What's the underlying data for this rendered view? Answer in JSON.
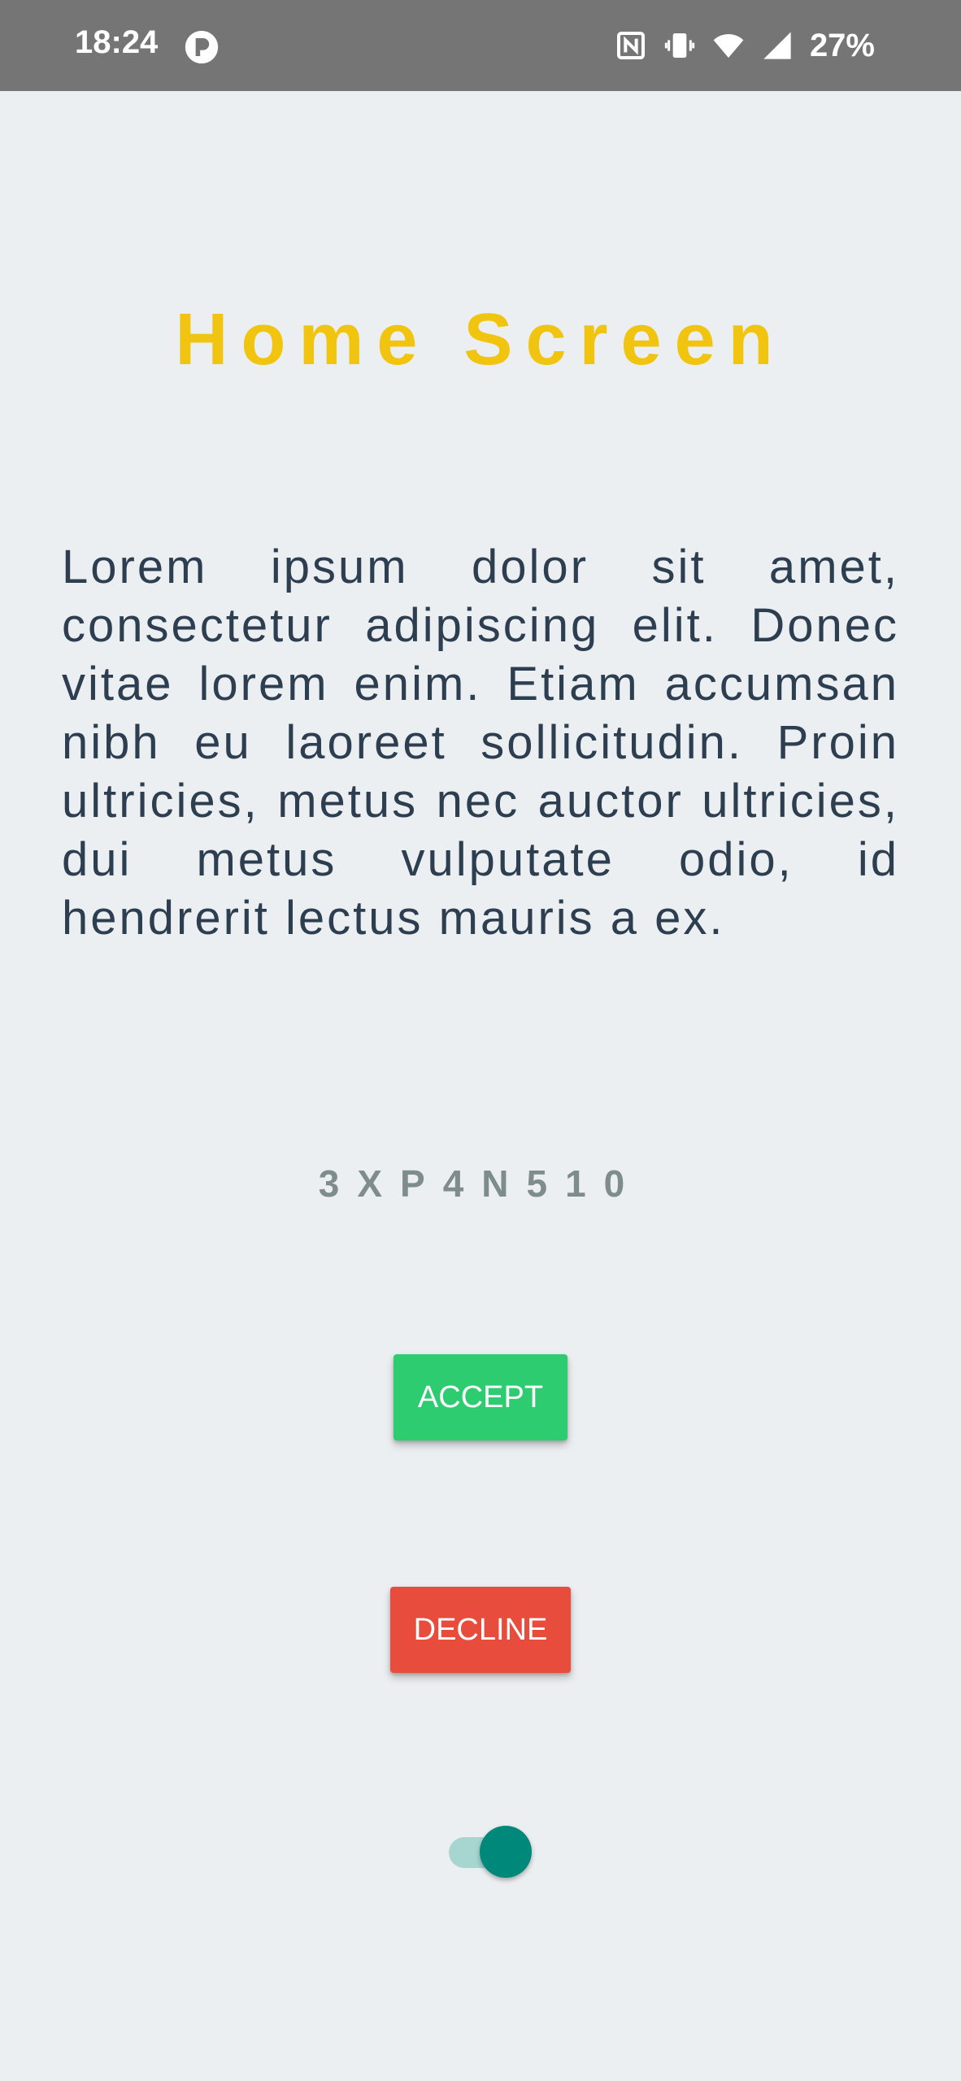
{
  "status_bar": {
    "time": "18:24",
    "battery_percent": "27%",
    "icons": [
      "app-notification-icon",
      "nfc-icon",
      "vibrate-icon",
      "wifi-icon",
      "cellular-signal-icon"
    ]
  },
  "screen": {
    "title": "Home Screen",
    "body": "Lorem ipsum dolor sit amet, consectetur adipiscing elit. Donec vitae lorem enim. Etiam accumsan nibh eu laoreet sollicitudin. Proin ultricies, metus nec auctor ultricies, dui metus vulputate odio, id hendrerit lectus mauris a ex.",
    "code": "3XP4N510"
  },
  "buttons": {
    "accept_label": "ACCEPT",
    "decline_label": "DECLINE"
  },
  "toggle": {
    "checked": true
  },
  "colors": {
    "background": "#ECEFF1",
    "status_bar": "#757575",
    "title": "#F1C40F",
    "body_text": "#2C3E50",
    "code_text": "#7F8C8D",
    "accept": "#2ECC71",
    "decline": "#E74C3C",
    "toggle_thumb": "#00897B",
    "toggle_track": "#A7D5D0"
  }
}
